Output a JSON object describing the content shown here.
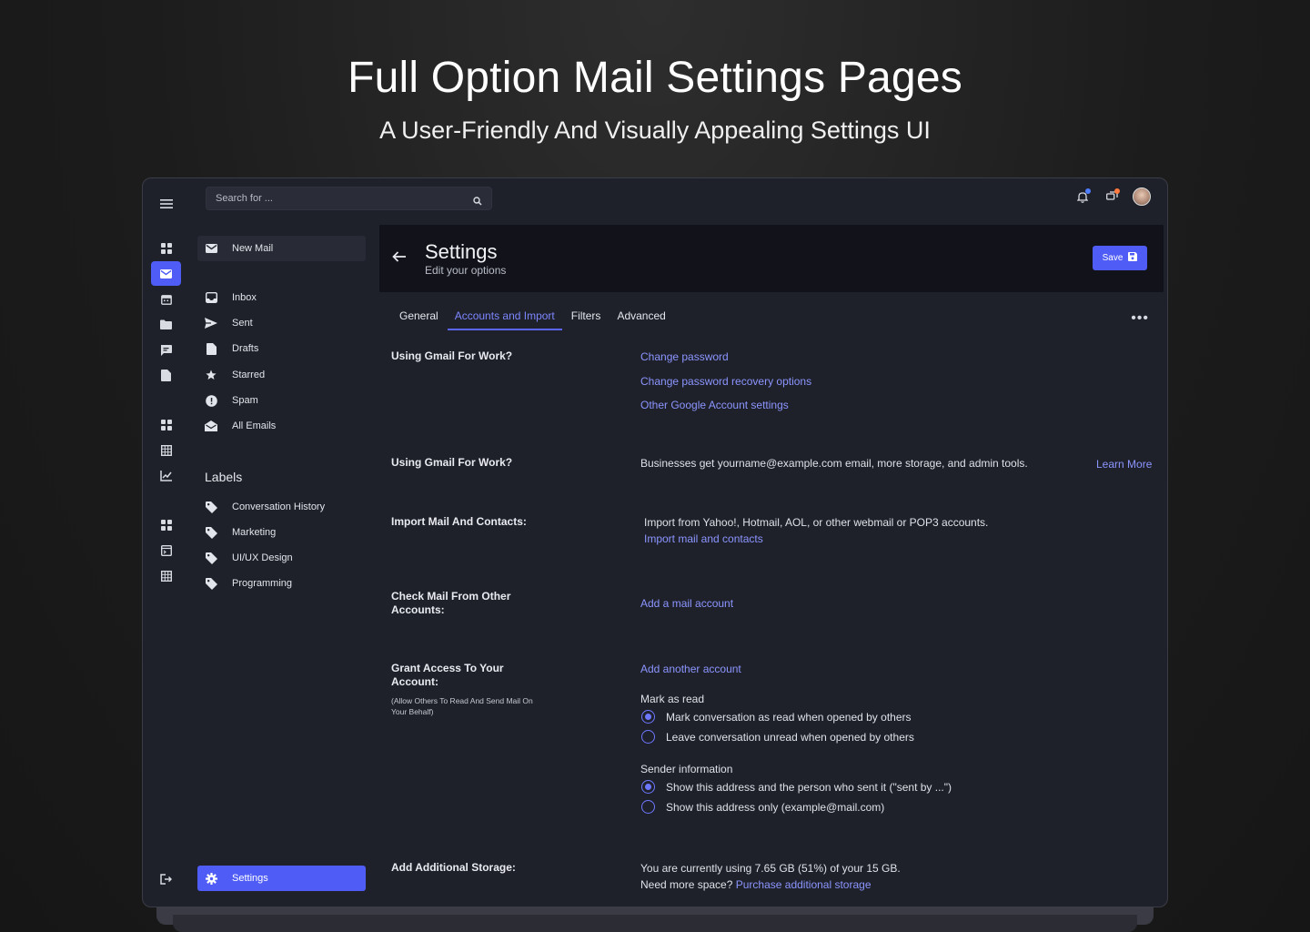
{
  "hero": {
    "title": "Full Option Mail Settings Pages",
    "subtitle": "A User-Friendly And Visually Appealing Settings UI"
  },
  "topbar": {
    "search_placeholder": "Search for ...",
    "icons": [
      "menu-icon",
      "search-icon",
      "bell-icon",
      "chat-icon",
      "avatar"
    ],
    "dot_colors": [
      "#4f7dff",
      "#ff7a3c"
    ]
  },
  "sidebar": {
    "new_mail": "New Mail",
    "items": [
      {
        "label": "Inbox",
        "icon": "inbox-icon"
      },
      {
        "label": "Sent",
        "icon": "send-icon"
      },
      {
        "label": "Drafts",
        "icon": "draft-icon"
      },
      {
        "label": "Starred",
        "icon": "star-icon"
      },
      {
        "label": "Spam",
        "icon": "spam-icon"
      },
      {
        "label": "All Emails",
        "icon": "all-mail-icon"
      }
    ],
    "labels_heading": "Labels",
    "labels": [
      {
        "label": "Conversation History",
        "icon": "tag-icon"
      },
      {
        "label": "Marketing",
        "icon": "tag-icon"
      },
      {
        "label": "UI/UX Design",
        "icon": "tag-icon"
      },
      {
        "label": "Programming",
        "icon": "tag-icon"
      }
    ],
    "settings": "Settings"
  },
  "header": {
    "title": "Settings",
    "subtitle": "Edit your options",
    "save_label": "Save"
  },
  "tabs": [
    {
      "label": "General",
      "active": false
    },
    {
      "label": "Accounts and Import",
      "active": true
    },
    {
      "label": "Filters",
      "active": false
    },
    {
      "label": "Advanced",
      "active": false
    }
  ],
  "sections": {
    "s1": {
      "label": "Using Gmail For Work?",
      "links": [
        "Change password",
        "Change password recovery options",
        "Other Google Account settings"
      ]
    },
    "s2": {
      "label": "Using Gmail For Work?",
      "text": "Businesses get yourname@example.com email, more storage, and admin tools.",
      "link": "Learn More"
    },
    "s3": {
      "label": "Import Mail And Contacts:",
      "text": "Import from Yahoo!, Hotmail, AOL, or other webmail or POP3 accounts.",
      "link": "Import mail and contacts"
    },
    "s4": {
      "label": "Check Mail From Other Accounts:",
      "link": "Add a mail account"
    },
    "s5": {
      "label": "Grant Access To Your Account:",
      "note": "(Allow Others To Read And Send Mail On Your Behalf)",
      "link": "Add another account",
      "mark_heading": "Mark as read",
      "mark_options": [
        {
          "label": "Mark conversation as read when opened by others",
          "checked": true
        },
        {
          "label": "Leave conversation unread when opened by others",
          "checked": false
        }
      ],
      "sender_heading": "Sender information",
      "sender_options": [
        {
          "label": "Show this address and the person who sent it (\"sent by ...\")",
          "checked": true
        },
        {
          "label": "Show this address only (example@mail.com)",
          "checked": false
        }
      ]
    },
    "s6": {
      "label": "Add Additional Storage:",
      "text": "You are currently using 7.65 GB (51%) of your 15 GB.",
      "text2": "Need more space?",
      "link": "Purchase additional storage"
    }
  },
  "colors": {
    "accent": "#4f5cf5",
    "link": "#8b95ff",
    "panel": "#12131a",
    "surface": "#1f212a"
  }
}
